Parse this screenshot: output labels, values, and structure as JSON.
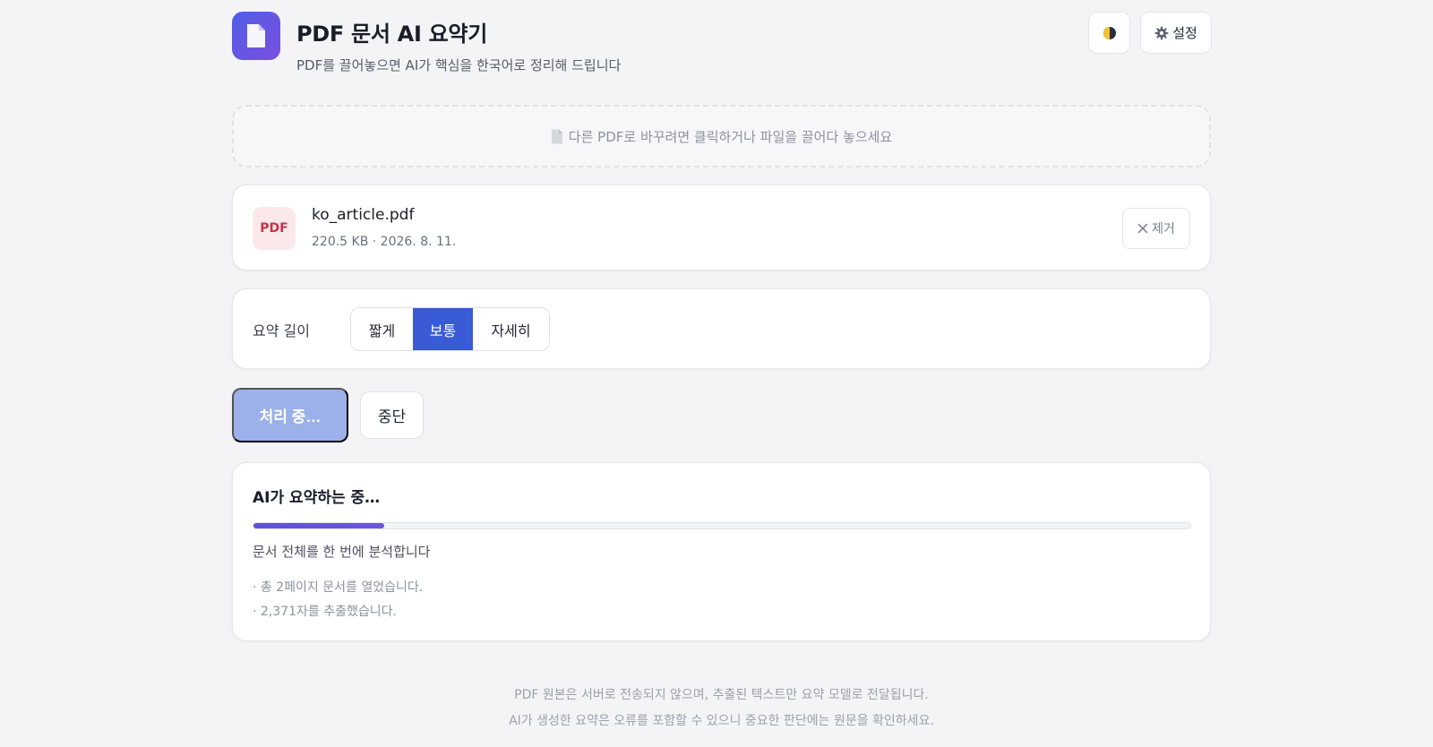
{
  "header": {
    "title": "PDF 문서 AI 요약기",
    "subtitle": "PDF를 끌어놓으면 AI가 핵심을 한국어로 정리해 드립니다",
    "logo_icon": "document-icon",
    "theme_icon": "half-moon-icon",
    "settings_icon": "gear-icon",
    "settings_label": "설정"
  },
  "dropzone": {
    "icon": "document-icon",
    "text": "다른 PDF로 바꾸려면 클릭하거나 파일을 끌어다 놓으세요"
  },
  "file": {
    "badge": "PDF",
    "name": "ko_article.pdf",
    "meta": "220.5 KB · 2026. 8. 11.",
    "remove_icon": "close-icon",
    "remove_label": "제거"
  },
  "length": {
    "label": "요약 길이",
    "options": [
      "짧게",
      "보통",
      "자세히"
    ],
    "selected": "보통"
  },
  "actions": {
    "process_label": "처리 중…",
    "stop_label": "중단"
  },
  "progress": {
    "title": "AI가 요약하는 중…",
    "fraction": 0.14,
    "status": "문서 전체를 한 번에 분석합니다",
    "logs": [
      "· 총 2페이지 문서를 열었습니다.",
      "· 2,371자를 추출했습니다."
    ]
  },
  "footer": {
    "line1": "PDF 원본은 서버로 전송되지 않으며, 추출된 텍스트만 요약 모델로 전달됩니다.",
    "line2": "AI가 생성한 요약은 오류를 포함할 수 있으니 중요한 판단에는 원문을 확인하세요."
  },
  "colors": {
    "accent": "#3a5bd6",
    "accent_disabled": "#9cb0ea",
    "progress": "#5e4fd9",
    "pdf_badge_bg": "#fbe8ea",
    "pdf_badge_text": "#c2354a"
  }
}
